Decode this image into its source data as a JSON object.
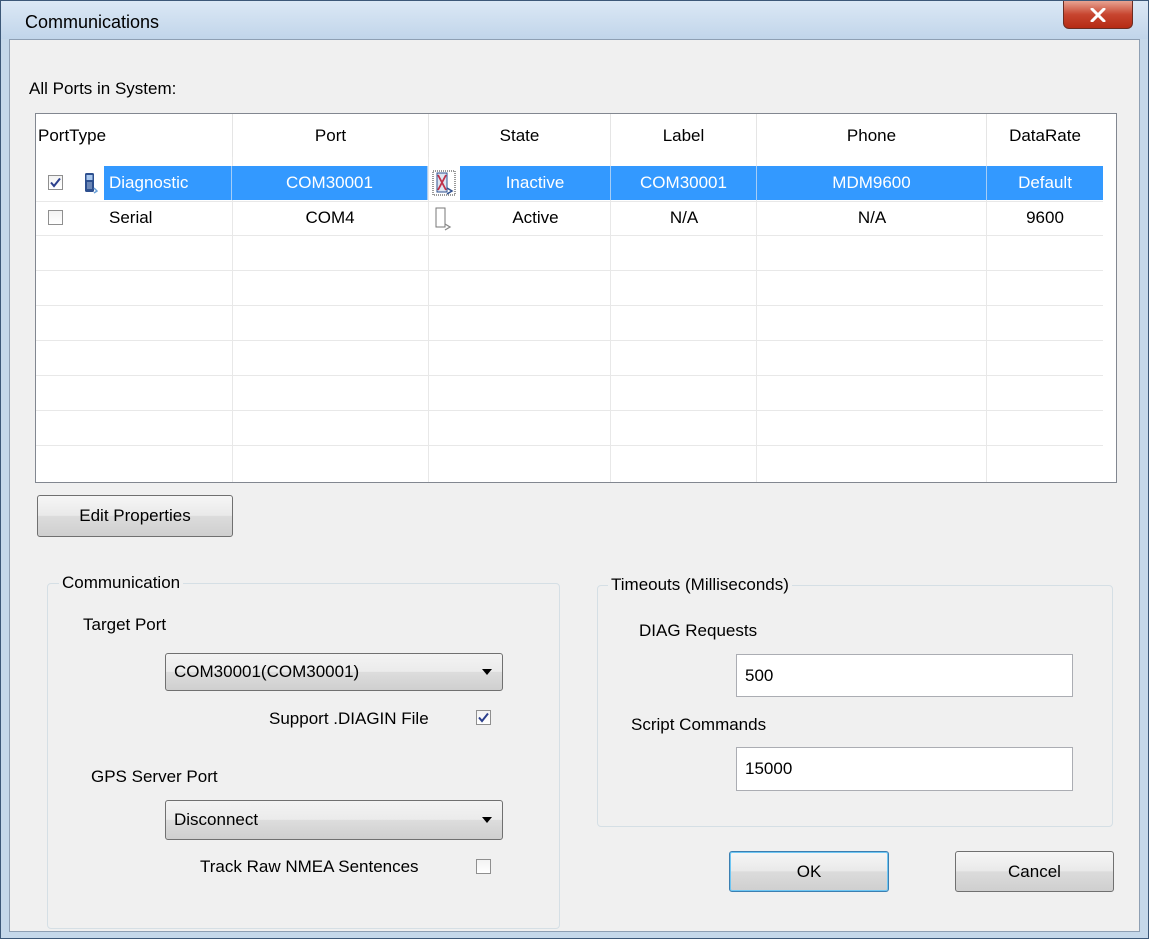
{
  "window": {
    "title": "Communications"
  },
  "ports": {
    "heading": "All Ports in System:",
    "columns": [
      "PortType",
      "Port",
      "State",
      "Label",
      "Phone",
      "DataRate"
    ],
    "rows": [
      {
        "checked": true,
        "porttype": "Diagnostic",
        "port": "COM30001",
        "state": "Inactive",
        "label": "COM30001",
        "phone": "MDM9600",
        "datarate": "Default",
        "selected": true
      },
      {
        "checked": false,
        "porttype": "Serial",
        "port": "COM4",
        "state": "Active",
        "label": "N/A",
        "phone": "N/A",
        "datarate": "9600",
        "selected": false
      }
    ]
  },
  "buttons": {
    "edit_properties": "Edit Properties",
    "ok": "OK",
    "cancel": "Cancel"
  },
  "communication": {
    "title": "Communication",
    "target_port_label": "Target Port",
    "target_port_value": "COM30001(COM30001)",
    "support_diagin_label": "Support .DIAGIN File",
    "support_diagin_checked": true,
    "gps_server_port_label": "GPS Server Port",
    "gps_server_port_value": "Disconnect",
    "track_nmea_label": "Track Raw NMEA Sentences",
    "track_nmea_checked": false
  },
  "timeouts": {
    "title": "Timeouts (Milliseconds)",
    "diag_requests_label": "DIAG Requests",
    "diag_requests_value": "500",
    "script_commands_label": "Script Commands",
    "script_commands_value": "15000"
  },
  "colors": {
    "selection": "#3399ff",
    "title_bar": "#c5d8ea",
    "close_button": "#c7452f"
  }
}
